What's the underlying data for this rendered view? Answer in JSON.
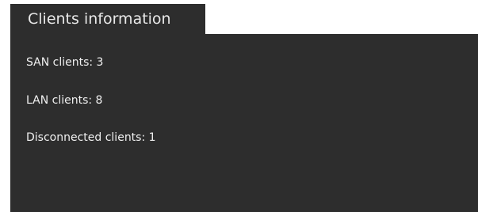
{
  "panel": {
    "title": "Clients information",
    "stats": [
      {
        "text": "SAN clients: 3"
      },
      {
        "text": "LAN clients: 8"
      },
      {
        "text": "Disconnected clients: 1"
      }
    ]
  }
}
